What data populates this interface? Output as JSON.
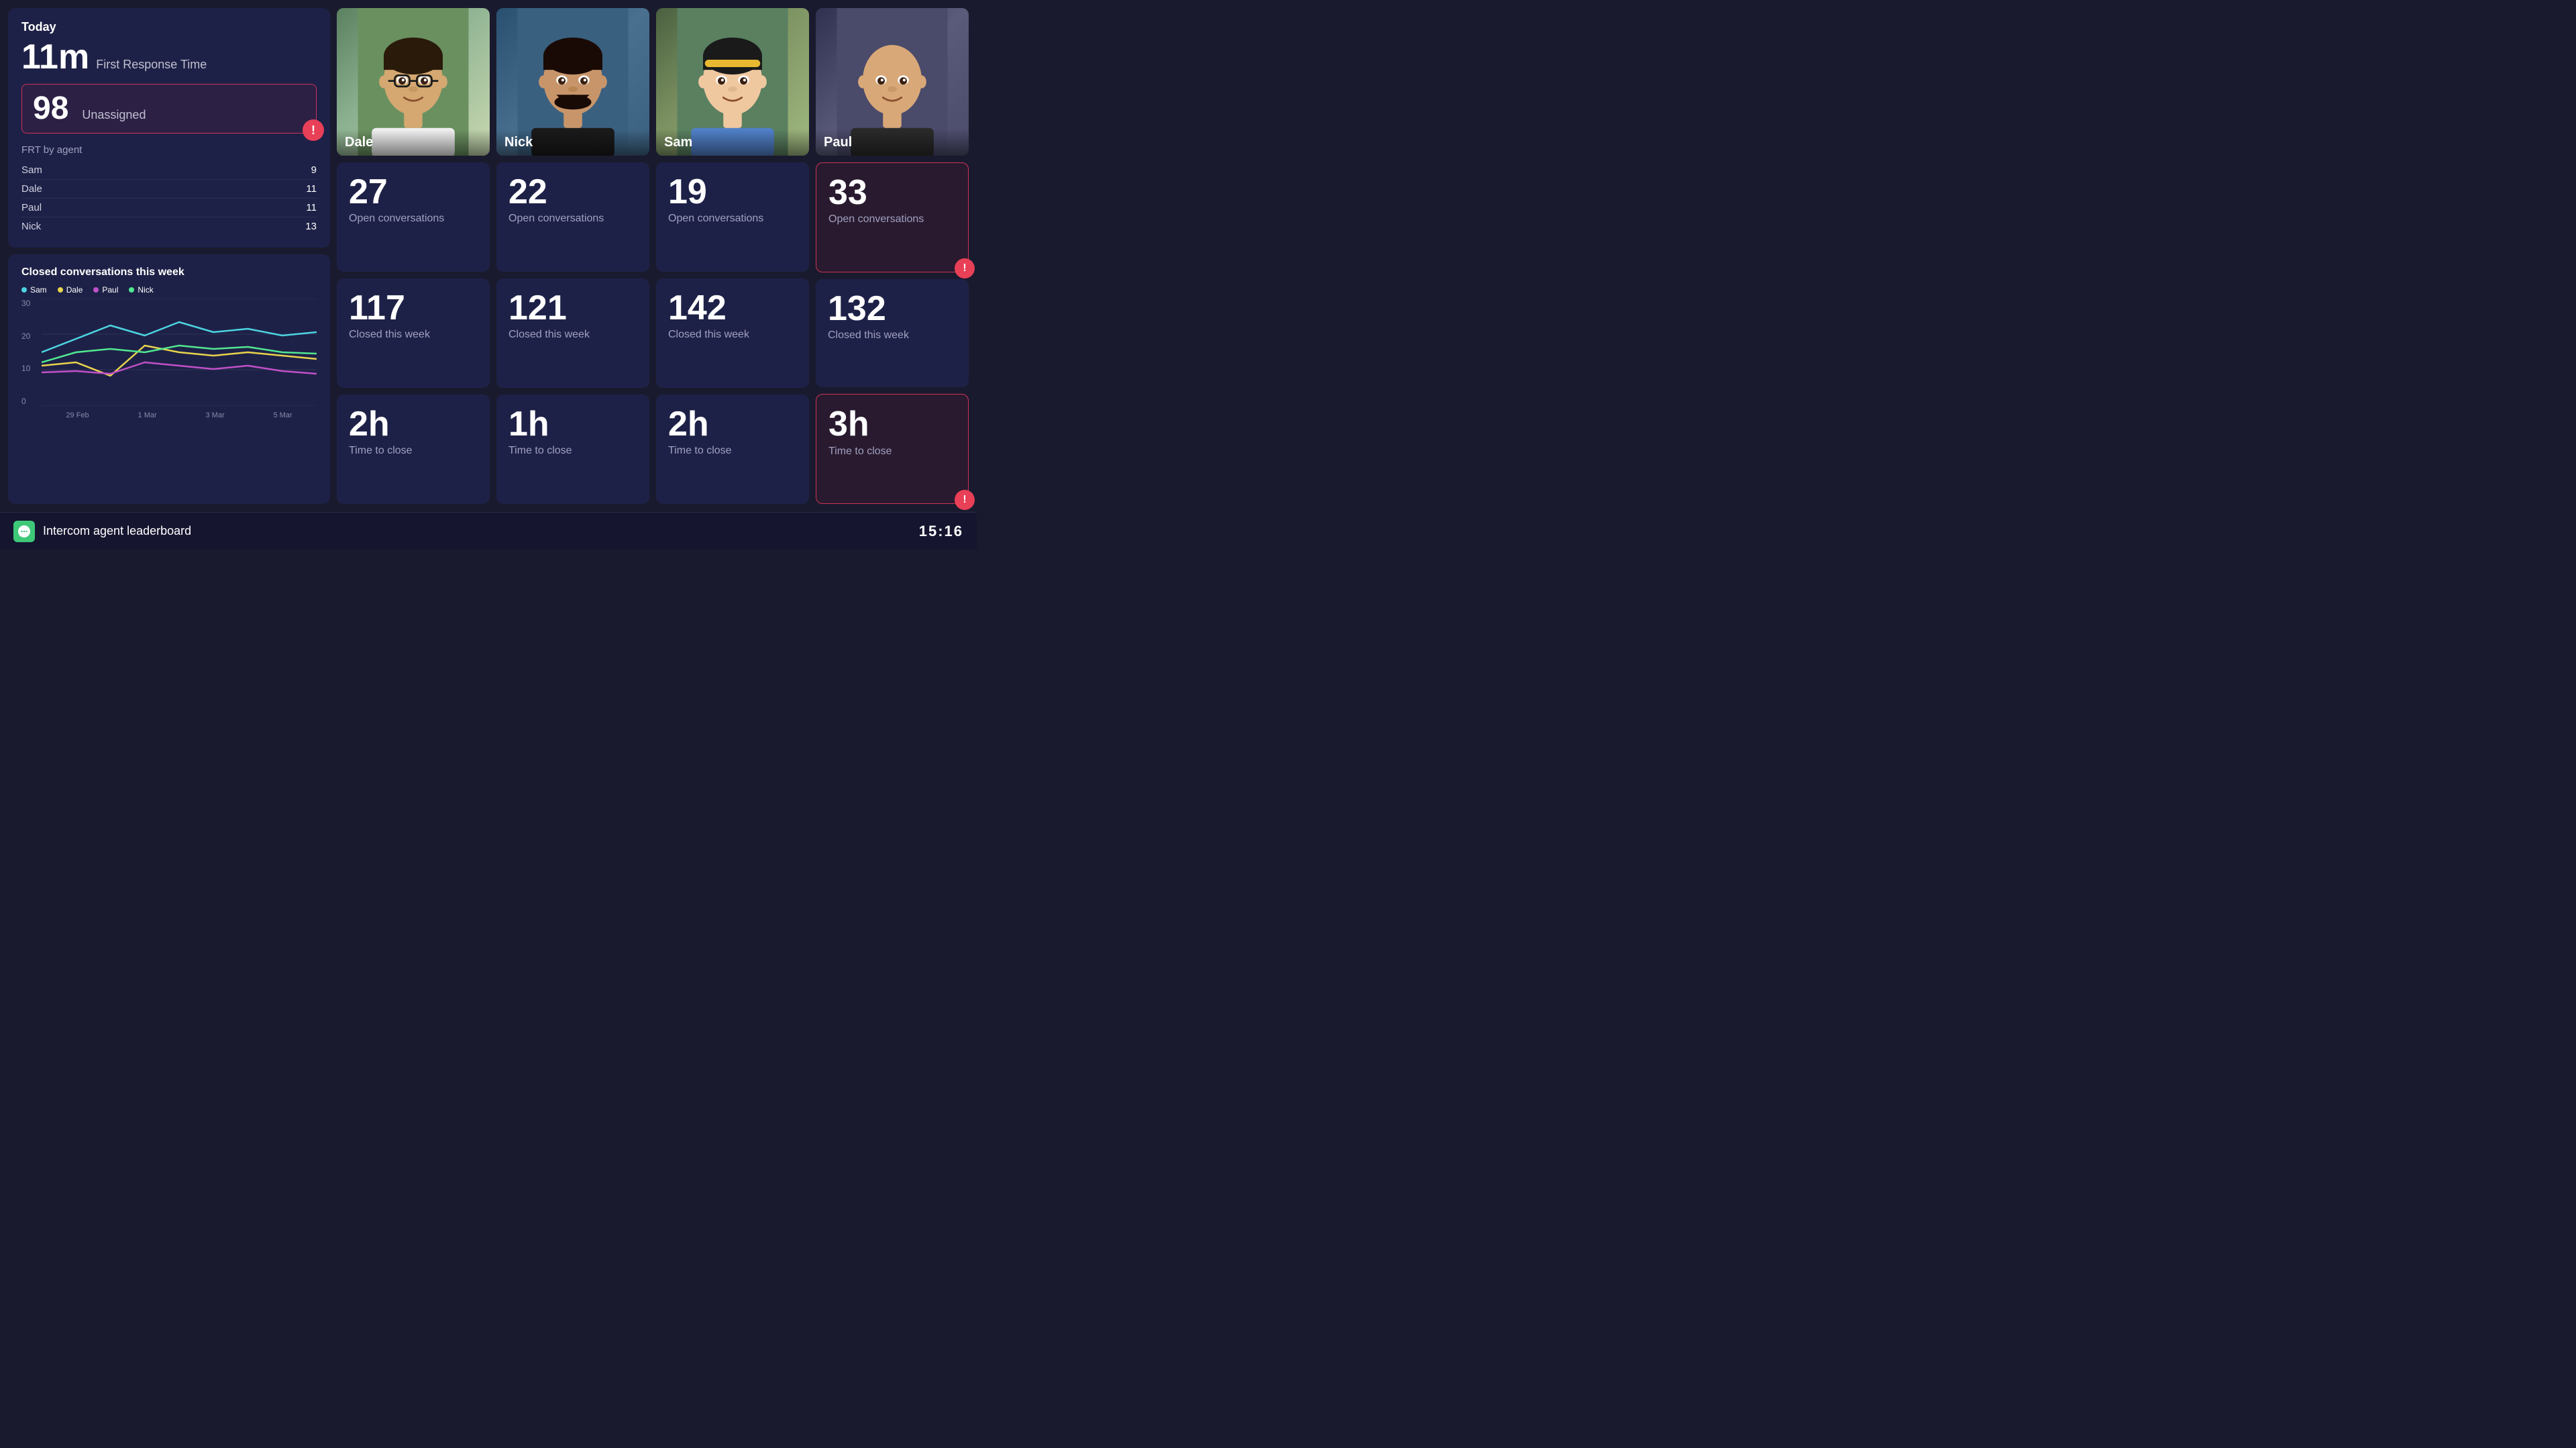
{
  "header": {
    "today_label": "Today"
  },
  "today_panel": {
    "frt_time": "11m",
    "frt_description": "First Response Time",
    "unassigned_count": "98",
    "unassigned_label": "Unassigned",
    "frt_by_agent_title": "FRT by agent",
    "agents_frt": [
      {
        "name": "Sam",
        "value": "9"
      },
      {
        "name": "Dale",
        "value": "11"
      },
      {
        "name": "Paul",
        "value": "11"
      },
      {
        "name": "Nick",
        "value": "13"
      }
    ]
  },
  "chart": {
    "title": "Closed conversations this week",
    "y_max": "30",
    "y_mid": "20",
    "y_low": "10",
    "y_min": "0",
    "x_labels": [
      "29 Feb",
      "1 Mar",
      "3 Mar",
      "5 Mar"
    ],
    "legend": [
      {
        "name": "Sam",
        "color": "#4cd4e0"
      },
      {
        "name": "Dale",
        "color": "#e8d44d"
      },
      {
        "name": "Paul",
        "color": "#c050c8"
      },
      {
        "name": "Nick",
        "color": "#50e890"
      }
    ]
  },
  "agents": [
    {
      "name": "Dale",
      "open_conversations": "27",
      "open_label": "Open conversations",
      "closed_this_week": "117",
      "closed_label": "Closed this week",
      "time_to_close": "2h",
      "ttc_label": "Time to close",
      "has_alert": false,
      "alert_on": ""
    },
    {
      "name": "Nick",
      "open_conversations": "22",
      "open_label": "Open conversations",
      "closed_this_week": "121",
      "closed_label": "Closed this week",
      "time_to_close": "1h",
      "ttc_label": "Time to close",
      "has_alert": false,
      "alert_on": ""
    },
    {
      "name": "Sam",
      "open_conversations": "19",
      "open_label": "Open conversations",
      "closed_this_week": "142",
      "closed_label": "Closed this week",
      "time_to_close": "2h",
      "ttc_label": "Time to close",
      "has_alert": false,
      "alert_on": ""
    },
    {
      "name": "Paul",
      "open_conversations": "33",
      "open_label": "Open conversations",
      "closed_this_week": "132",
      "closed_label": "Closed this week",
      "time_to_close": "3h",
      "ttc_label": "Time to close",
      "has_alert": true,
      "alert_on": "open"
    }
  ],
  "bottom_bar": {
    "brand_name": "Intercom agent leaderboard",
    "time": "15:16"
  },
  "alert_icon": "!"
}
